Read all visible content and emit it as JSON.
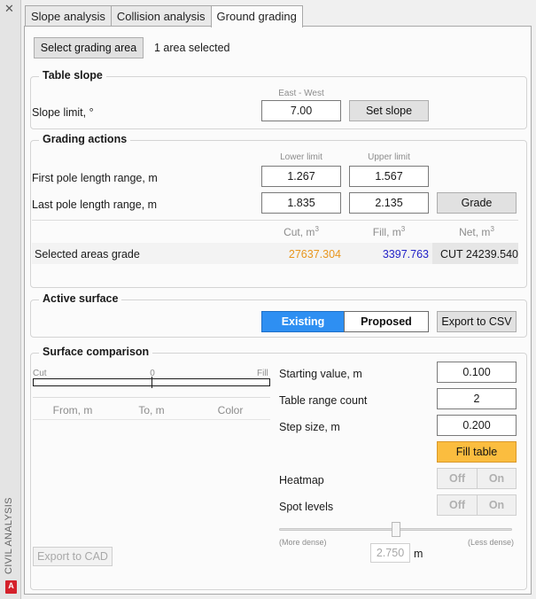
{
  "palette": {
    "side_label": "CIVIL ANALYSIS",
    "logo_letter": "A"
  },
  "tabs": [
    {
      "label": "Slope analysis"
    },
    {
      "label": "Collision analysis"
    },
    {
      "label": "Ground grading"
    }
  ],
  "grading_area": {
    "button_label": "Select grading area",
    "status": "1 area selected"
  },
  "table_slope": {
    "title": "Table slope",
    "direction_label": "East - West",
    "slope_label": "Slope limit, °",
    "slope_value": "7.00",
    "set_button": "Set slope"
  },
  "grading_actions": {
    "title": "Grading actions",
    "lower_limit": "Lower limit",
    "upper_limit": "Upper limit",
    "first_label": "First pole length range, m",
    "first_lower": "1.267",
    "first_upper": "1.567",
    "last_label": "Last pole length range, m",
    "last_lower": "1.835",
    "last_upper": "2.135",
    "grade_button": "Grade",
    "col_cut": "Cut, m",
    "col_fill": "Fill, m",
    "col_net": "Net, m",
    "unit_exp": "3",
    "row_label": "Selected areas grade",
    "cut_value": "27637.304",
    "fill_value": "3397.763",
    "net_value": "CUT 24239.540",
    "cut_color": "#e8961e",
    "fill_color": "#2323c8"
  },
  "active_surface": {
    "title": "Active surface",
    "existing": "Existing",
    "proposed": "Proposed",
    "export_csv": "Export to CSV"
  },
  "surface_comparison": {
    "title": "Surface comparison",
    "scale_cut": "Cut",
    "scale_zero": "0",
    "scale_fill": "Fill",
    "col_from": "From, m",
    "col_to": "To, m",
    "col_color": "Color",
    "starting_label": "Starting value, m",
    "starting_value": "0.100",
    "range_label": "Table range count",
    "range_value": "2",
    "step_label": "Step size, m",
    "step_value": "0.200",
    "fill_table": "Fill table",
    "heatmap_label": "Heatmap",
    "spot_label": "Spot levels",
    "off": "Off",
    "on": "On",
    "more_dense": "(More dense)",
    "less_dense": "(Less dense)",
    "density_value": "2.750",
    "density_unit": "m",
    "density_level": 0.5,
    "export_cad": "Export to CAD",
    "fill_button_color": "#fbbd3f"
  }
}
